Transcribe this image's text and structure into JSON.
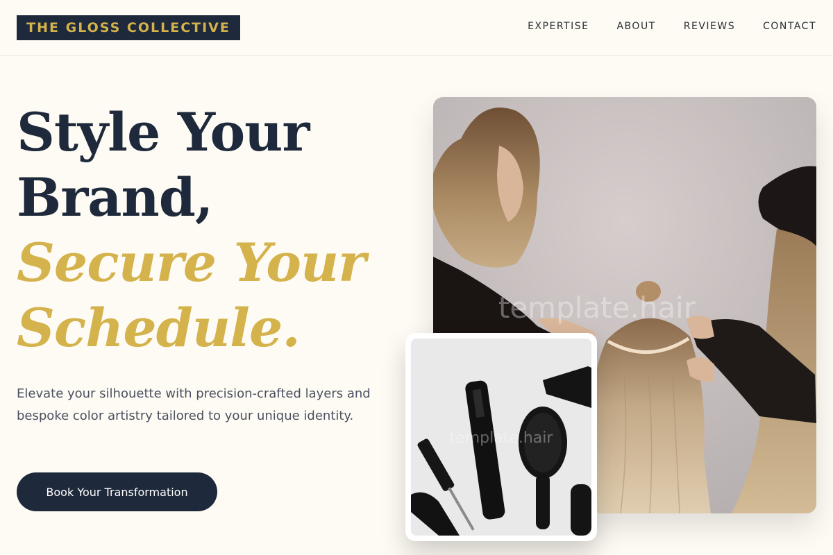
{
  "header": {
    "logo": "THE GLOSS COLLECTIVE",
    "nav": [
      "EXPERTISE",
      "ABOUT",
      "REVIEWS",
      "CONTACT"
    ]
  },
  "hero": {
    "line1": "Style Your",
    "line2": "Brand,",
    "line3": "Secure Your",
    "line4": "Schedule.",
    "subtext": "Elevate your silhouette with precision-crafted layers and bespoke color artistry tailored to your unique identity.",
    "cta": "Book Your Transformation"
  },
  "images": {
    "main_watermark": "template.hair",
    "tools_watermark": "template.hair"
  },
  "colors": {
    "navy": "#1e293b",
    "gold": "#d4b24c",
    "background": "#fdfbf3"
  }
}
